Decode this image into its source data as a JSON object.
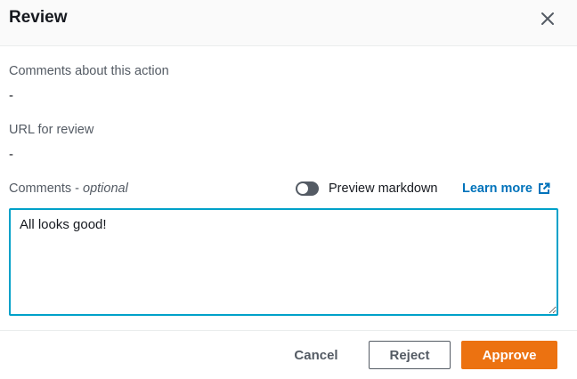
{
  "dialog": {
    "title": "Review"
  },
  "fields": {
    "action_comments_label": "Comments about this action",
    "action_comments_value": "-",
    "review_url_label": "URL for review",
    "review_url_value": "-"
  },
  "comments": {
    "label": "Comments",
    "separator": " - ",
    "optional": "optional",
    "value": "All looks good!"
  },
  "preview_toggle": {
    "label": "Preview markdown",
    "enabled": false
  },
  "learn_more": {
    "label": "Learn more",
    "icon": "external-link-icon"
  },
  "buttons": {
    "cancel": "Cancel",
    "reject": "Reject",
    "approve": "Approve"
  },
  "colors": {
    "accent": "#ec7211",
    "link": "#0073bb",
    "focus": "#00a1c9",
    "text": "#16191f",
    "secondary": "#545b64"
  }
}
